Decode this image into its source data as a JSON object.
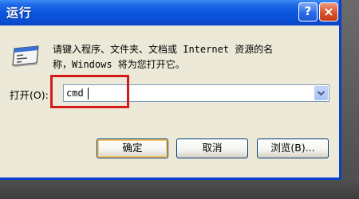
{
  "window": {
    "title": "运行",
    "help_label": "?",
    "close_label": "×"
  },
  "description": {
    "line1": "请键入程序、文件夹、文档或 Internet 资源的名",
    "line2": "称，Windows 将为您打开它。"
  },
  "open_field": {
    "label": "打开(O):",
    "value": "cmd"
  },
  "buttons": {
    "ok": "确定",
    "cancel": "取消",
    "browse": "浏览(B)..."
  },
  "colors": {
    "titlebar": "#0a55dd",
    "dialog_bg": "#ece9d8",
    "highlight": "#d61a1a"
  },
  "icons": {
    "run": "run-program-icon",
    "combo_arrow": "chevron-down-icon"
  }
}
